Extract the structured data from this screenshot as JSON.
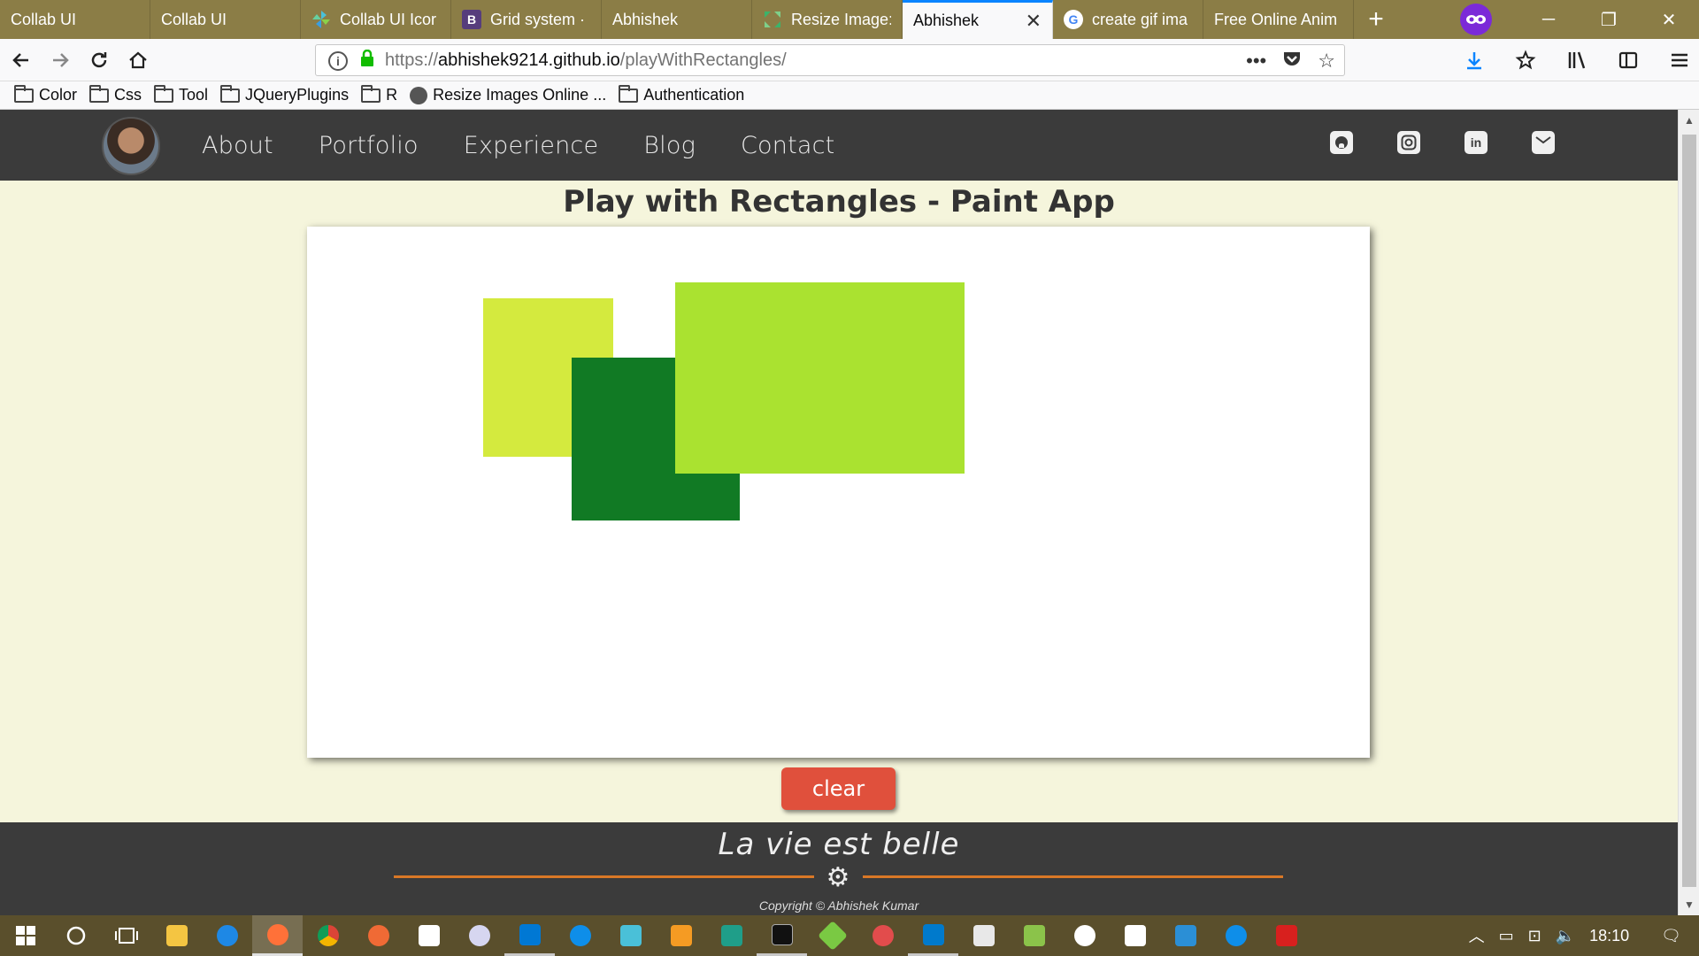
{
  "browser": {
    "tabs": [
      {
        "title": "Collab UI",
        "active": false,
        "favicon": ""
      },
      {
        "title": "Collab UI",
        "active": false,
        "favicon": ""
      },
      {
        "title": "Collab UI Icor",
        "active": false,
        "favicon": "pinwheel"
      },
      {
        "title": "Grid system ·",
        "active": false,
        "favicon": "B"
      },
      {
        "title": "Abhishek",
        "active": false,
        "favicon": ""
      },
      {
        "title": "Resize Image:",
        "active": false,
        "favicon": "resize"
      },
      {
        "title": "Abhishek",
        "active": true,
        "favicon": ""
      },
      {
        "title": "create gif ima",
        "active": false,
        "favicon": "G"
      },
      {
        "title": "Free Online Anim",
        "active": false,
        "favicon": ""
      }
    ],
    "url_scheme": "https://",
    "url_host": "abhishek9214.github.io",
    "url_path": "/playWithRectangles/",
    "bookmarks": [
      {
        "label": "Color",
        "type": "folder"
      },
      {
        "label": "Css",
        "type": "folder"
      },
      {
        "label": "Tool",
        "type": "folder"
      },
      {
        "label": "JQueryPlugins",
        "type": "folder"
      },
      {
        "label": "R",
        "type": "folder"
      },
      {
        "label": "Resize Images Online ...",
        "type": "link"
      },
      {
        "label": "Authentication",
        "type": "folder"
      }
    ]
  },
  "site": {
    "nav": [
      "About",
      "Portfolio",
      "Experience",
      "Blog",
      "Contact"
    ],
    "social_icons": [
      "github-icon",
      "instagram-icon",
      "linkedin-icon",
      "mail-icon"
    ],
    "page_title": "Play with Rectangles - Paint App",
    "clear_label": "clear",
    "tagline": "La vie est belle",
    "copyright": "Copyright © Abhishek Kumar"
  },
  "canvas": {
    "rectangles": [
      {
        "color": "#d4ea3e"
      },
      {
        "color": "#117a24"
      },
      {
        "color": "#aae230"
      }
    ]
  },
  "taskbar": {
    "time": "18:10",
    "apps": [
      "file-explorer",
      "edge",
      "firefox",
      "chrome",
      "paint",
      "mail",
      "itunes",
      "outlook",
      "teamviewer",
      "pinwheel",
      "html",
      "sql",
      "terminal",
      "git",
      "visual-studio",
      "vscode",
      "pdf",
      "sheet",
      "mongodb",
      "sublime",
      "window",
      "teamviewer2",
      "acrobat"
    ],
    "colors": {
      "taskbar": "#5a4f2c",
      "tabbar": "#8b7d46",
      "header": "#3b3b3b",
      "page_bg": "#f5f5dc",
      "accent": "#e0503c"
    }
  }
}
